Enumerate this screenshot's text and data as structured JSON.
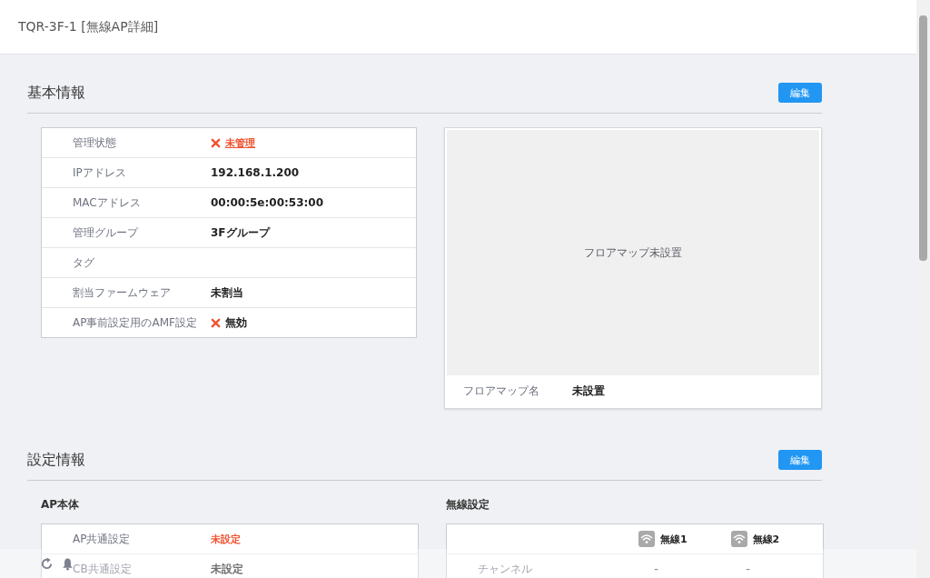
{
  "header": {
    "title": "TQR-3F-1 [無線AP詳細]"
  },
  "basic": {
    "title": "基本情報",
    "edit_button": "編集",
    "rows": [
      {
        "label": "管理状態",
        "value": "未管理",
        "kind": "error_link"
      },
      {
        "label": "IPアドレス",
        "value": "192.168.1.200",
        "kind": "plain"
      },
      {
        "label": "MACアドレス",
        "value": "00:00:5e:00:53:00",
        "kind": "plain"
      },
      {
        "label": "管理グループ",
        "value": "3Fグループ",
        "kind": "plain"
      },
      {
        "label": "タグ",
        "kind": "plain"
      },
      {
        "label": "割当ファームウェア",
        "value": "未割当",
        "kind": "plain"
      },
      {
        "label": "AP事前設定用のAMF設定",
        "value": "無効",
        "kind": "cross"
      }
    ],
    "floor_map": {
      "placeholder": "フロアマップ未設置",
      "name_label": "フロアマップ名",
      "name_value": "未設置"
    }
  },
  "settings": {
    "title": "設定情報",
    "edit_button": "編集",
    "ap_body": {
      "title": "AP本体",
      "rows": [
        {
          "label": "AP共通設定",
          "value": "未設定",
          "kind": "red"
        },
        {
          "label": "CB共通設定",
          "value": "未設定",
          "kind": "plain"
        }
      ]
    },
    "wireless": {
      "title": "無線設定",
      "columns": [
        "無線1",
        "無線2"
      ],
      "rows": [
        {
          "label": "チャンネル",
          "values": [
            "-",
            "-"
          ]
        }
      ]
    }
  }
}
